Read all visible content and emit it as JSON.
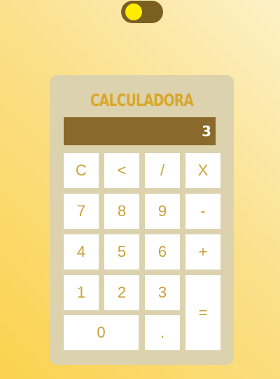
{
  "theme_toggle": {
    "state": "on",
    "track_color": "#7a5f22",
    "knob_color": "#ffec00"
  },
  "calculator": {
    "title": "CALCULADORA",
    "display_value": "3",
    "keys": {
      "clear": "C",
      "backspace": "<",
      "divide": "/",
      "multiply": "X",
      "seven": "7",
      "eight": "8",
      "nine": "9",
      "minus": "-",
      "four": "4",
      "five": "5",
      "six": "6",
      "plus": "+",
      "one": "1",
      "two": "2",
      "three": "3",
      "equals": "=",
      "zero": "0",
      "decimal": "."
    }
  },
  "colors": {
    "panel": "#dcd2ad",
    "display": "#8a6a2c",
    "accent": "#d9a72b",
    "key_text": "#c9a13a"
  }
}
